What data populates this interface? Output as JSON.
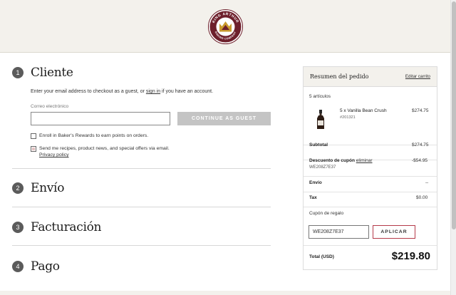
{
  "brand": {
    "logo_alt": "KING ARTHUR BAKING COMPANY",
    "logo_top_text": "KING ARTHUR",
    "logo_bottom_text": "BAKING COMPANY",
    "colors": {
      "maroon": "#6d1f2b",
      "gold": "#c99a2e",
      "header_bg": "#f3f1ec",
      "accent_red": "#b53a4a"
    }
  },
  "steps": [
    {
      "number": "1",
      "title": "Cliente"
    },
    {
      "number": "2",
      "title": "Envío"
    },
    {
      "number": "3",
      "title": "Facturación"
    },
    {
      "number": "4",
      "title": "Pago"
    }
  ],
  "customer": {
    "intro_before": "Enter your email address to checkout as a guest, or ",
    "intro_link": "sign in",
    "intro_after": " if you have an account.",
    "email_label": "Correo electrónico",
    "email_value": "",
    "guest_button": "CONTINUE AS GUEST",
    "rewards_label": "Enroll in Baker's Rewards to earn points on orders.",
    "rewards_checked": false,
    "newsletter_label": "Send me recipes, product news, and special offers via email.",
    "newsletter_checked": true,
    "privacy_link": "Privacy policy"
  },
  "summary": {
    "title": "Resumen del pedido",
    "edit_link": "Editar carrito",
    "item_count": "5 artículos",
    "item": {
      "name": "5 x Vanilla Bean Crush",
      "sku": "#201321",
      "price": "$274.75",
      "icon": "bottle-icon"
    },
    "subtotal_label": "Subtotal",
    "subtotal_value": "$274.75",
    "discount_label": "Descuento de cupón",
    "discount_remove": "eliminar",
    "discount_code": "WE208Z7E37",
    "discount_value": "-$54.95",
    "shipping_label": "Envío",
    "shipping_value": "--",
    "tax_label": "Tax",
    "tax_value": "$0.00",
    "coupon_label": "Cupón de regalo",
    "coupon_value": "WE208Z7E37",
    "apply_button": "APLICAR",
    "total_label": "Total (USD)",
    "total_value": "$219.80"
  }
}
